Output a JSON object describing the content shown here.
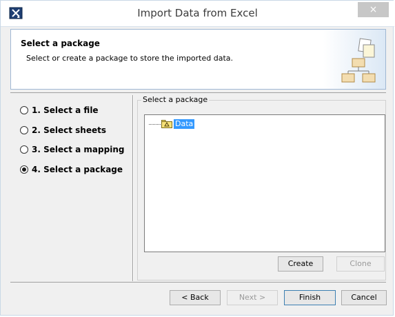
{
  "window": {
    "title": "Import Data from Excel",
    "close_glyph": "×"
  },
  "header": {
    "title": "Select a package",
    "description": "Select or create a package to store the imported data."
  },
  "steps": [
    {
      "label": "1. Select a file",
      "checked": false
    },
    {
      "label": "2. Select sheets",
      "checked": false
    },
    {
      "label": "3. Select a mapping",
      "checked": false
    },
    {
      "label": "4. Select a package",
      "checked": true
    }
  ],
  "package_group": {
    "label": "Select a package"
  },
  "tree": {
    "items": [
      {
        "label": "Data",
        "icon": "package-icon",
        "selected": true
      }
    ]
  },
  "buttons": {
    "create": "Create",
    "clone": "Clone",
    "back": "< Back",
    "next": "Next >",
    "finish": "Finish",
    "cancel": "Cancel"
  },
  "colors": {
    "selection": "#3399ff",
    "header_border": "#9fb7d3",
    "package_icon": "#f7e27a"
  }
}
